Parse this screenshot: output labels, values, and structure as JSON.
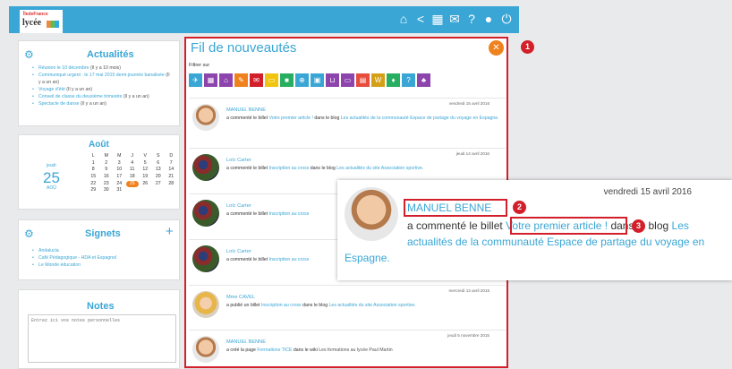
{
  "header": {
    "logo_top": "ÎledeFrance",
    "logo_main": "lycée",
    "icons": [
      "home-icon",
      "share-icon",
      "apps-grid-icon",
      "mail-icon",
      "help-icon",
      "user-avatar-icon",
      "power-icon"
    ]
  },
  "news": {
    "title": "Actualités",
    "items": [
      {
        "link": "Réunion le 10 décembre",
        "meta": "(Il y a 10 mois)"
      },
      {
        "link": "Communiqué urgent : le 17 mai 2015 demi-journée banalisée",
        "meta": "(Il y a un an)"
      },
      {
        "link": "Voyage d'été",
        "meta": "(Il y a un an)"
      },
      {
        "link": "Conseil de classe du deuxième trimestre",
        "meta": "(Il y a un an)"
      },
      {
        "link": "Spectacle de danse",
        "meta": "(Il y a un an)"
      }
    ]
  },
  "calendar": {
    "month": "Août",
    "day_name": "jeudi",
    "day_num": "25",
    "day_month": "AOÛ",
    "headers": [
      "L",
      "M",
      "M",
      "J",
      "V",
      "S",
      "D"
    ],
    "cells": [
      "1",
      "2",
      "3",
      "4",
      "5",
      "6",
      "7",
      "8",
      "9",
      "10",
      "11",
      "12",
      "13",
      "14",
      "15",
      "16",
      "17",
      "18",
      "19",
      "20",
      "21",
      "22",
      "23",
      "24",
      "25",
      "26",
      "27",
      "28",
      "29",
      "30",
      "31"
    ],
    "today": "25"
  },
  "bookmarks": {
    "title": "Signets",
    "add_symbol": "+",
    "items": [
      "Andalucia",
      "Café Pédagogique - HDA et Espagnol",
      "Le Monde éducation"
    ]
  },
  "notes": {
    "title": "Notes",
    "placeholder": "Entrez ici vos notes personnelles"
  },
  "feed": {
    "title": "Fil de nouveautés",
    "filter_label": "Filtrer sur",
    "filter_colors": [
      "#3aa6d5",
      "#8e44ad",
      "#8e44ad",
      "#f0821e",
      "#d21f2a",
      "#f1c40f",
      "#27ae60",
      "#3aa6d5",
      "#3aa6d5",
      "#8e44ad",
      "#8e44ad",
      "#e74c3c",
      "#d4a017",
      "#27ae60",
      "#3aa6d5",
      "#8e44ad"
    ],
    "items": [
      {
        "date": "vendredi 15 avril 2016",
        "author": "MANUEL BENNE",
        "pre": "a commenté le billet",
        "link1": "Votre premier article !",
        "mid": "dans le blog",
        "link2": "Les actualités de la communauté Espace de partage du voyage en Espagne."
      },
      {
        "date": "jeudi 14 avril 2016",
        "author": "Loïc Carter",
        "pre": "a commenté le billet",
        "link1": "Inscription au cross",
        "mid": "dans le blog",
        "link2": "Les actualités du site Association sportive."
      },
      {
        "date": "",
        "author": "Loïc Carter",
        "pre": "a commenté le billet",
        "link1": "Inscription au cross",
        "mid": "",
        "link2": ""
      },
      {
        "date": "",
        "author": "Loïc Carter",
        "pre": "a commenté le billet",
        "link1": "Inscription au cross",
        "mid": "",
        "link2": ""
      },
      {
        "date": "mercredi 13 avril 2016",
        "author": "Mme CAVEL",
        "pre": "a publié un billet",
        "link1": "Inscription au cross",
        "mid": "dans le blog",
        "link2": "Les actualités du site Association sportive."
      },
      {
        "date": "jeudi 5 novembre 2015",
        "author": "MANUEL BENNE",
        "pre": "a créé la page",
        "link1": "Formations TICE",
        "mid": "dans le wiki",
        "link2": "Les formations au lycée Paul Martin"
      }
    ]
  },
  "zoom": {
    "date": "vendredi 15 avril 2016",
    "author": "MANUEL BENNE",
    "pre": "a commenté le billet",
    "link1": "Votre premier article !",
    "mid": "dans le blog",
    "link2a": "Les",
    "link2b": "actualités de la communauté Espace de partage du voyage en",
    "link2c": "Espagne."
  },
  "callouts": [
    "1",
    "2",
    "3"
  ],
  "colors": {
    "accent": "#3aa6d5",
    "highlight": "#d21f2a",
    "today": "#f0821e"
  }
}
